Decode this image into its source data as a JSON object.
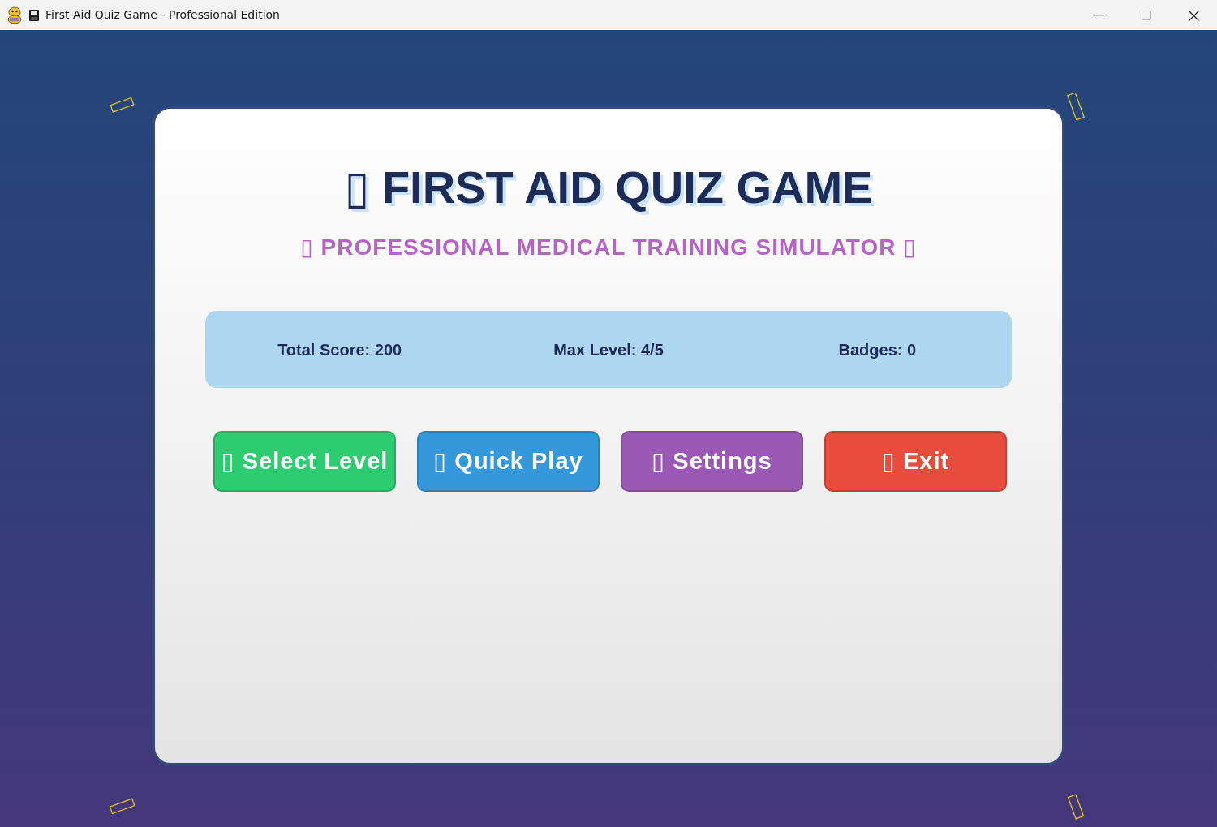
{
  "window": {
    "title": "First Aid Quiz Game - Professional Edition"
  },
  "header": {
    "title": "▯ FIRST AID QUIZ GAME",
    "subtitle": "▯ PROFESSIONAL MEDICAL TRAINING SIMULATOR ▯"
  },
  "stats": [
    "Total Score: 200",
    "Max Level: 4/5",
    "Badges: 0"
  ],
  "buttons": [
    {
      "label": "▯ Select Level",
      "color": "#2ecc71"
    },
    {
      "label": "▯ Quick Play",
      "color": "#3498db"
    },
    {
      "label": "▯ Settings",
      "color": "#9b59b6"
    },
    {
      "label": "▯ Exit",
      "color": "#e74c3c"
    }
  ]
}
